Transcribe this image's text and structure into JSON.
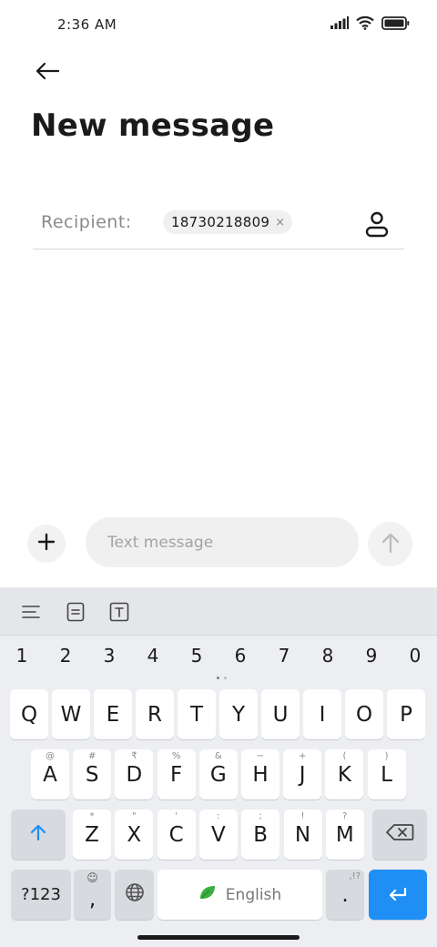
{
  "status_bar": {
    "time": "2:36 AM"
  },
  "header": {
    "title": "New message"
  },
  "recipient": {
    "label": "Recipient:",
    "chip": "18730218809",
    "chip_close": "×"
  },
  "compose": {
    "placeholder": "Text message"
  },
  "keyboard": {
    "number_row": [
      "1",
      "2",
      "3",
      "4",
      "5",
      "6",
      "7",
      "8",
      "9",
      "0"
    ],
    "row1": [
      {
        "k": "Q",
        "s": ""
      },
      {
        "k": "W",
        "s": ""
      },
      {
        "k": "E",
        "s": ""
      },
      {
        "k": "R",
        "s": ""
      },
      {
        "k": "T",
        "s": ""
      },
      {
        "k": "Y",
        "s": ""
      },
      {
        "k": "U",
        "s": ""
      },
      {
        "k": "I",
        "s": ""
      },
      {
        "k": "O",
        "s": ""
      },
      {
        "k": "P",
        "s": ""
      }
    ],
    "row2": [
      {
        "k": "A",
        "s": "@"
      },
      {
        "k": "S",
        "s": "#"
      },
      {
        "k": "D",
        "s": "₹"
      },
      {
        "k": "F",
        "s": "%"
      },
      {
        "k": "G",
        "s": "&"
      },
      {
        "k": "H",
        "s": "−"
      },
      {
        "k": "J",
        "s": "+"
      },
      {
        "k": "K",
        "s": "("
      },
      {
        "k": "L",
        "s": ")"
      }
    ],
    "row3": [
      {
        "k": "Z",
        "s": "*"
      },
      {
        "k": "X",
        "s": "\""
      },
      {
        "k": "C",
        "s": "'"
      },
      {
        "k": "V",
        "s": ":"
      },
      {
        "k": "B",
        "s": ";"
      },
      {
        "k": "N",
        "s": "!"
      },
      {
        "k": "M",
        "s": "?"
      }
    ],
    "symbols_label": "?123",
    "emoji_sub": "☺",
    "emoji_key": ",",
    "space_label": "English",
    "period_key": ".",
    "period_sub": ",!?"
  },
  "colors": {
    "accent": "#1f8ff6",
    "leaf": "#3cae3f"
  }
}
